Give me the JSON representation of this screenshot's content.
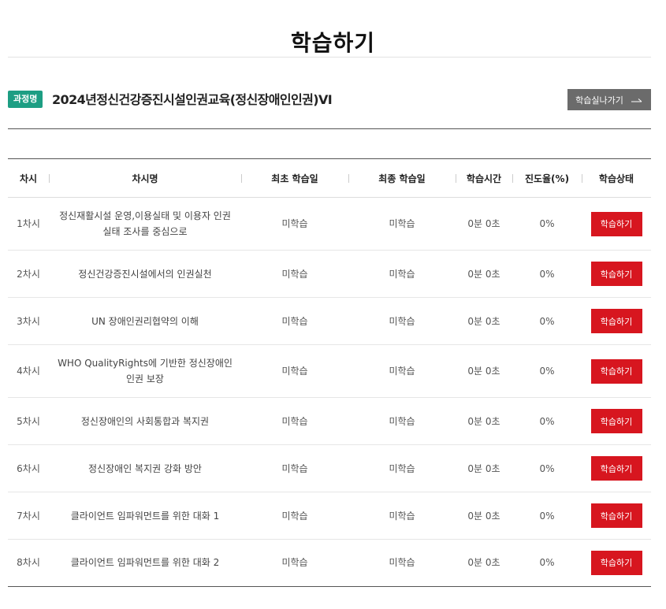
{
  "page": {
    "title": "학습하기"
  },
  "course": {
    "badge": "과정명",
    "title": "2024년정신건강증진시설인권교육(정신장애인인권)VI",
    "go_button_label": "학습실나가기"
  },
  "table": {
    "headers": {
      "session": "차시",
      "name": "차시명",
      "first_date": "최초 학습일",
      "last_date": "최종 학습일",
      "time": "학습시간",
      "progress": "진도율(%)",
      "status": "학습상태"
    },
    "rows": [
      {
        "session": "1차시",
        "name": "정신재활시설 운영,이용실태 및 이용자 인권 실태 조사를 중심으로",
        "first_date": "미학습",
        "last_date": "미학습",
        "time": "0분 0초",
        "progress": "0%",
        "action": "학습하기"
      },
      {
        "session": "2차시",
        "name": "정신건강증진시설에서의 인권실천",
        "first_date": "미학습",
        "last_date": "미학습",
        "time": "0분 0초",
        "progress": "0%",
        "action": "학습하기"
      },
      {
        "session": "3차시",
        "name": "UN 장애인권리협약의 이해",
        "first_date": "미학습",
        "last_date": "미학습",
        "time": "0분 0초",
        "progress": "0%",
        "action": "학습하기"
      },
      {
        "session": "4차시",
        "name": "WHO QualityRights에 기반한 정신장애인 인권 보장",
        "first_date": "미학습",
        "last_date": "미학습",
        "time": "0분 0초",
        "progress": "0%",
        "action": "학습하기"
      },
      {
        "session": "5차시",
        "name": "정신장애인의 사회통합과 복지권",
        "first_date": "미학습",
        "last_date": "미학습",
        "time": "0분 0초",
        "progress": "0%",
        "action": "학습하기"
      },
      {
        "session": "6차시",
        "name": "정신장애인 복지권 강화 방안",
        "first_date": "미학습",
        "last_date": "미학습",
        "time": "0분 0초",
        "progress": "0%",
        "action": "학습하기"
      },
      {
        "session": "7차시",
        "name": "클라이언트 임파워먼트를 위한 대화 1",
        "first_date": "미학습",
        "last_date": "미학습",
        "time": "0분 0초",
        "progress": "0%",
        "action": "학습하기"
      },
      {
        "session": "8차시",
        "name": "클라이언트 임파워먼트를 위한 대화 2",
        "first_date": "미학습",
        "last_date": "미학습",
        "time": "0분 0초",
        "progress": "0%",
        "action": "학습하기"
      }
    ]
  }
}
